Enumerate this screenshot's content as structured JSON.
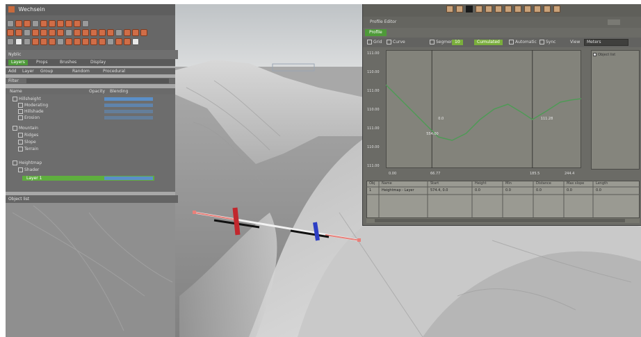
{
  "app": {
    "title": "Wechsein"
  },
  "left_panel": {
    "header_label": "Nyblic",
    "tabs": [
      "Layers",
      "Props",
      "Brushes",
      "Display"
    ],
    "sub_tabs": [
      "Add",
      "Layer",
      "Group",
      "Random",
      "Procedural"
    ],
    "filter_label": "Filter",
    "col_headers": [
      "Name",
      "Opacity",
      "Blending"
    ],
    "layers": [
      {
        "name": "Hillsheight",
        "enabled": true
      },
      {
        "name": "Moderating",
        "enabled": true
      },
      {
        "name": "Hillshade",
        "enabled": true
      },
      {
        "name": "Erosion",
        "enabled": true
      },
      {
        "name": "Mountain",
        "enabled": true
      },
      {
        "name": "Ridges",
        "enabled": true
      },
      {
        "name": "Slope",
        "enabled": true
      },
      {
        "name": "Terrain",
        "enabled": true
      },
      {
        "name": "Heightmap",
        "enabled": true
      },
      {
        "name": "Shader",
        "enabled": true
      },
      {
        "name": "Layer 1",
        "enabled": true
      }
    ],
    "bottom_section_label": "Object list"
  },
  "profile_window": {
    "title": "Profile Editor",
    "tab": "Profile",
    "toolbar": {
      "grid_label": "Grid",
      "curve_label": "Curve",
      "segments_label": "Segments",
      "segments_value": "10",
      "cumulated_label": "Cumulated",
      "auto_label": "Automatic",
      "sync_label": "Sync",
      "view_label": "View",
      "view_value": "Meters"
    },
    "side_label": "Object list",
    "table": {
      "headers": [
        "Obj",
        "Name",
        "Start",
        "Height",
        "Min",
        "Distance",
        "Max slope",
        "Length"
      ],
      "rows": [
        [
          "1",
          "Heightmap - Layer",
          "574.4, 0.0",
          "0.0",
          "0.0",
          "0.0",
          "0.0",
          "0.0"
        ]
      ]
    }
  },
  "chart_data": {
    "type": "line",
    "title": "",
    "xlabel": "",
    "ylabel": "",
    "x_ticks": [
      "0.00",
      "66.77",
      "185.5",
      "244.4"
    ],
    "y_ticks": [
      "111.00",
      "110.00",
      "111.00",
      "110.00",
      "111.00",
      "110.00",
      "111.00"
    ],
    "grid": false,
    "xlim": [
      0,
      280
    ],
    "ylim": [
      0,
      170
    ],
    "markers": [
      {
        "x": 66,
        "label": "0.0"
      },
      {
        "x": 210,
        "label": ""
      }
    ],
    "series": [
      {
        "color": "#4f9a56",
        "x": [
          0,
          20,
          45,
          65,
          75,
          95,
          115,
          135,
          155,
          175,
          195,
          210,
          230,
          250,
          265,
          280
        ],
        "y": [
          120,
          100,
          75,
          55,
          45,
          40,
          50,
          70,
          85,
          92,
          80,
          70,
          82,
          95,
          98,
          100
        ]
      }
    ],
    "point_labels": [
      {
        "x": 58,
        "y": 48,
        "label": "554.00"
      },
      {
        "x": 222,
        "y": 70,
        "label": "111.28"
      },
      {
        "x": 75,
        "y": 70,
        "label": "0.0"
      }
    ]
  }
}
